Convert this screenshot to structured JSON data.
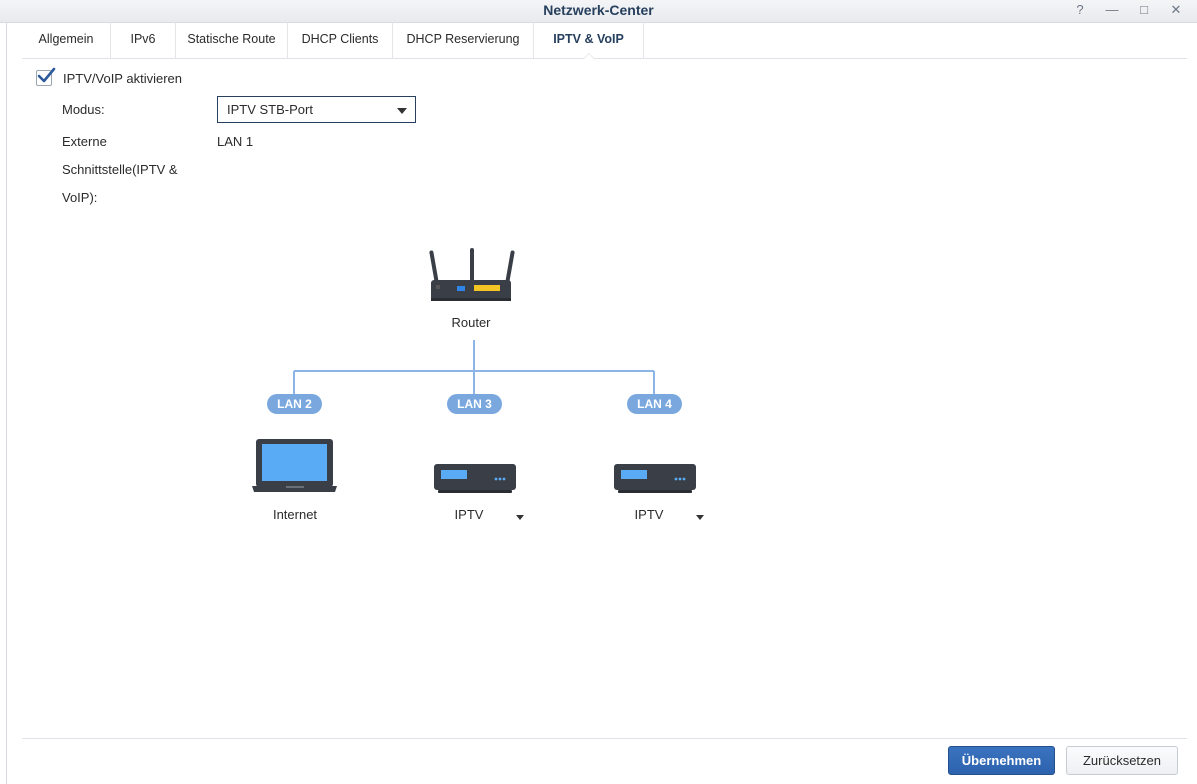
{
  "window": {
    "title": "Netzwerk-Center",
    "help_glyph": "?",
    "minimize_glyph": "—",
    "maximize_glyph": "□",
    "close_glyph": "✕"
  },
  "tabs": [
    {
      "label": "Allgemein"
    },
    {
      "label": "IPv6"
    },
    {
      "label": "Statische Route"
    },
    {
      "label": "DHCP Clients"
    },
    {
      "label": "DHCP Reservierung"
    },
    {
      "label": "IPTV & VoIP",
      "active": true
    }
  ],
  "form": {
    "enable_label": "IPTV/VoIP aktivieren",
    "enable_checked": true,
    "mode_label": "Modus:",
    "mode_value": "IPTV STB-Port",
    "external_label_line1": "Externe",
    "external_label_line2": "Schnittstelle(IPTV &",
    "external_label_line3": "VoIP):",
    "external_value": "LAN 1"
  },
  "diagram": {
    "router_label": "Router",
    "ports": [
      {
        "name": "LAN 2",
        "device": "laptop-icon",
        "device_label": "Internet",
        "has_dropdown": false
      },
      {
        "name": "LAN 3",
        "device": "settop-box-icon",
        "device_label": "IPTV",
        "has_dropdown": true
      },
      {
        "name": "LAN 4",
        "device": "settop-box-icon",
        "device_label": "IPTV",
        "has_dropdown": true
      }
    ],
    "colors": {
      "line": "#8db4e6",
      "pill": "#7aa8de",
      "screen": "#5aabf5",
      "device": "#3a3f47"
    }
  },
  "buttons": {
    "apply": "Übernehmen",
    "reset": "Zurücksetzen"
  },
  "colors": {
    "primary": "#2d62ad",
    "title": "#27405e"
  }
}
